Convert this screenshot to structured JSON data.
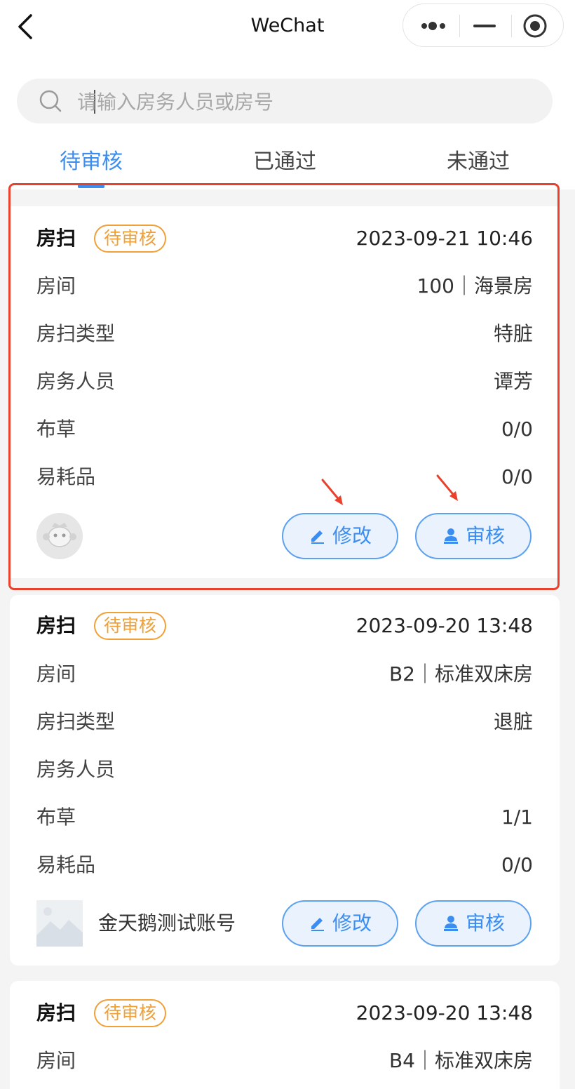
{
  "app": {
    "title": "WeChat"
  },
  "search": {
    "placeholder": "请输入房务人员或房号"
  },
  "tabs": [
    {
      "label": "待审核",
      "active": true
    },
    {
      "label": "已通过",
      "active": false
    },
    {
      "label": "未通过",
      "active": false
    }
  ],
  "labels": {
    "room": "房间",
    "clean_type": "房扫类型",
    "staff": "房务人员",
    "linen": "布草",
    "consumables": "易耗品",
    "edit_button": "修改",
    "review_button": "审核"
  },
  "cards": [
    {
      "type": "房扫",
      "status": "待审核",
      "time": "2023-09-21 10:46",
      "room": "100｜海景房",
      "clean_type": "特脏",
      "staff": "谭芳",
      "linen": "0/0",
      "consumables": "0/0",
      "account_name": ""
    },
    {
      "type": "房扫",
      "status": "待审核",
      "time": "2023-09-20 13:48",
      "room": "B2｜标准双床房",
      "clean_type": "退脏",
      "staff": "",
      "linen": "1/1",
      "consumables": "0/0",
      "account_name": "金天鹅测试账号"
    },
    {
      "type": "房扫",
      "status": "待审核",
      "time": "2023-09-20 13:48",
      "room": "B4｜标准双床房"
    }
  ],
  "colors": {
    "accent": "#3b8df0",
    "badge": "#f0a036",
    "annotation": "#e8412e"
  }
}
